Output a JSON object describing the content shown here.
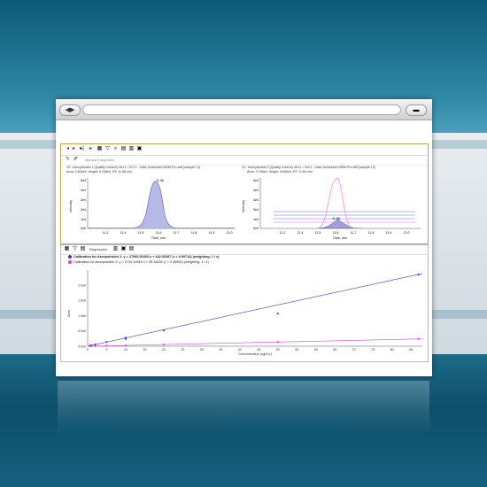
{
  "browser": {
    "back": "◀",
    "forward": "▶",
    "menu": "▬"
  },
  "toolbar": {
    "manual_integration": "Manual Integration",
    "regression": "Regression"
  },
  "pane_left": {
    "title": "10 - Azoxystrobin 1 (Quality Control) 404.1 / 372.1 - Data Scheduled MRM Pro.wiff (sample 13)",
    "subtitle": "Area: 2.602e5, Height: 5.038e4, RT: 11.58 min",
    "peak_label": "11.58",
    "y_ticks": [
      "5e4",
      "4e4",
      "3e4",
      "2e4",
      "1e4",
      "0e0"
    ],
    "x_ticks": [
      "11.3",
      "11.4",
      "11.5",
      "11.6",
      "11.7",
      "11.8",
      "11.9",
      "12.0"
    ],
    "y_axis": "Intensity",
    "x_axis": "Time, min"
  },
  "pane_right": {
    "title": "10 - Azoxystrobin 2 (Quality Control) 404.1 / 344.1 - Data Scheduled MRM Pro.wiff (sample 13)",
    "subtitle": "Area: 3.768e4, Height: 8.840e3, RT: 11.60 min",
    "peak_label": "11.58",
    "y_ticks": [
      "5e4",
      "4e4",
      "3e4",
      "2e4",
      "1e4",
      "0e0"
    ],
    "x_ticks": [
      "11.3",
      "11.4",
      "11.5",
      "11.6",
      "11.7",
      "11.8",
      "11.9",
      "12.0"
    ],
    "y_axis": "Intensity",
    "x_axis": "Time, min"
  },
  "calibration": {
    "line1": "Calibration for Azoxystrobin 1: y = 27093.60393 x + 442.52387 (r = 0.99714) (weighting: 1 / x)",
    "line2": "Calibration for Azoxystrobin 2: y = 2734.10610 x + 35.34252 (r = 0.99604) (weighting: 1 / x)"
  },
  "colors": {
    "series1": "#3b3bd1",
    "series2": "#e33fd1",
    "panel_border": "#c7a24c"
  },
  "chart_data": {
    "type": "scatter",
    "xlabel": "Concentration (ng/mL)",
    "ylabel": "Area",
    "xlim": [
      0,
      88
    ],
    "ylim": [
      0,
      2500000
    ],
    "x_ticks": [
      0,
      5,
      10,
      15,
      20,
      25,
      30,
      35,
      40,
      45,
      50,
      55,
      60,
      65,
      70,
      75,
      80,
      85
    ],
    "y_ticks": [
      {
        "v": 0,
        "label": "0.0e0"
      },
      {
        "v": 500000,
        "label": "5.0e5"
      },
      {
        "v": 1000000,
        "label": "1.0e6"
      },
      {
        "v": 1500000,
        "label": "1.5e6"
      },
      {
        "v": 2000000,
        "label": "2.0e6"
      }
    ],
    "series": [
      {
        "name": "Calibration for Azoxystrobin 1",
        "color": "#3b3bd1",
        "x": [
          0.5,
          1,
          2,
          5,
          10,
          10,
          20,
          50,
          87
        ],
        "y": [
          15000,
          30000,
          55000,
          140000,
          240000,
          280000,
          520000,
          1070000,
          2350000
        ],
        "fit": {
          "slope": 27093.60393,
          "intercept": 442.52387
        }
      },
      {
        "name": "Calibration for Azoxystrobin 2",
        "color": "#e33fd1",
        "x": [
          0.5,
          1,
          2,
          5,
          10,
          20,
          50,
          87
        ],
        "y": [
          2000,
          3500,
          6000,
          14000,
          27000,
          55000,
          137000,
          238000
        ],
        "fit": {
          "slope": 2734.1061,
          "intercept": 35.34252
        }
      }
    ]
  }
}
